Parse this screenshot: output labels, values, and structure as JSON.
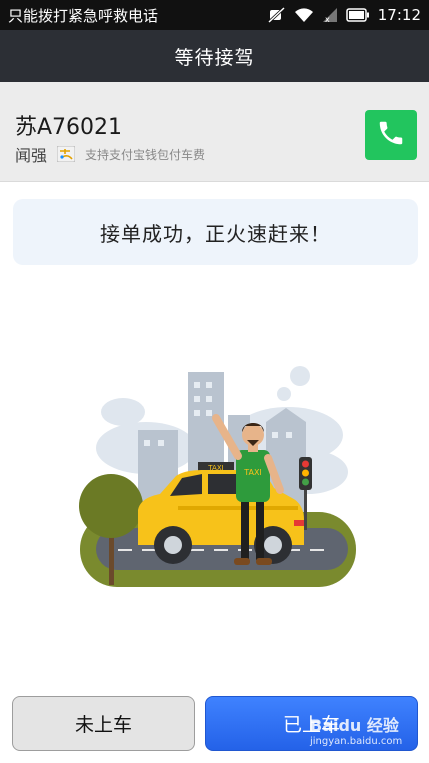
{
  "status_bar": {
    "carrier_text": "只能拨打紧急呼救电话",
    "time": "17:12",
    "icons": [
      "mute-icon",
      "wifi-icon",
      "signal-icon",
      "battery-icon"
    ]
  },
  "header": {
    "title": "等待接驾"
  },
  "driver": {
    "plate": "苏A76021",
    "name": "闻强",
    "payment_note": "支持支付宝钱包付车费",
    "call_icon": "phone-icon"
  },
  "notice": {
    "text": "接单成功，正火速赶来！"
  },
  "illustration": {
    "sign_text": "TAXI",
    "shirt_text": "TAXI"
  },
  "buttons": {
    "not_boarded": "未上车",
    "boarded": "已上车"
  },
  "watermark": {
    "brand": "Baidu 经验",
    "url": "jingyan.baidu.com"
  },
  "colors": {
    "header_bg": "#2c2f35",
    "call_green": "#22c55e",
    "primary_blue": "#2f6ff2",
    "taxi_yellow": "#f7c21a"
  }
}
